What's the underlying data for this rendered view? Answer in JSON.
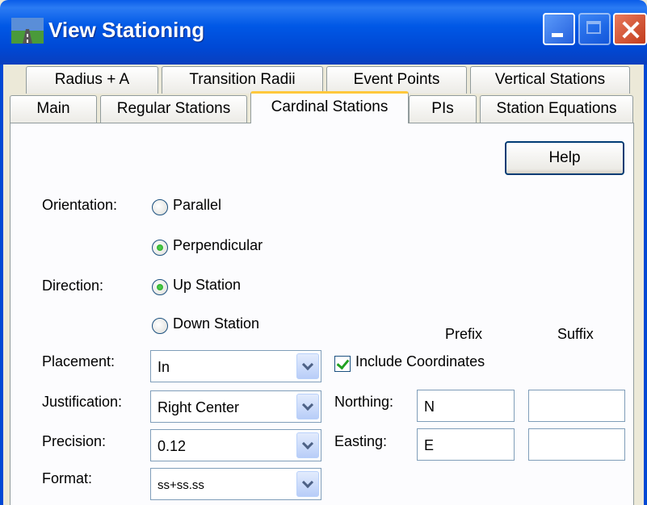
{
  "window": {
    "title": "View Stationing",
    "icon": "road-icon"
  },
  "tabs": {
    "row1": [
      "Radius + A",
      "Transition Radii",
      "Event Points",
      "Vertical Stations"
    ],
    "row2": [
      "Main",
      "Regular Stations",
      "Cardinal Stations",
      "PIs",
      "Station Equations"
    ],
    "active": "Cardinal Stations"
  },
  "help_label": "Help",
  "orientation": {
    "label": "Orientation:",
    "options": [
      "Parallel",
      "Perpendicular"
    ],
    "selected": "Perpendicular"
  },
  "direction": {
    "label": "Direction:",
    "options": [
      "Up Station",
      "Down Station"
    ],
    "selected": "Up Station"
  },
  "placement": {
    "label": "Placement:",
    "value": "In"
  },
  "justification": {
    "label": "Justification:",
    "value": "Right Center"
  },
  "precision": {
    "label": "Precision:",
    "value": "0.12"
  },
  "format": {
    "label": "Format:",
    "value": "ss+ss.ss"
  },
  "coordinates": {
    "prefix_header": "Prefix",
    "suffix_header": "Suffix",
    "include_label": "Include Coordinates",
    "include_checked": true,
    "northing": {
      "label": "Northing:",
      "prefix": "N",
      "suffix": ""
    },
    "easting": {
      "label": "Easting:",
      "prefix": "E",
      "suffix": ""
    }
  },
  "colors": {
    "titlebar": "#0058e6",
    "active_tab_accent": "#ffc83c",
    "panel": "#fcfcfe",
    "radio_dot": "#21a121"
  }
}
